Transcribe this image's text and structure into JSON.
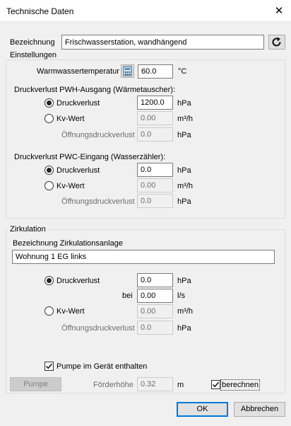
{
  "window": {
    "title": "Technische Daten",
    "close_glyph": "✕"
  },
  "bezeichnung": {
    "label": "Bezeichnung",
    "value": "Frischwasserstation, wandhängend",
    "refresh_icon": "refresh-icon"
  },
  "einstellungen": {
    "group_title": "Einstellungen",
    "warmwasser": {
      "label": "Warmwassertemperatur",
      "value": "60.0",
      "unit": "°C",
      "icon": "calculator-icon"
    },
    "pwh": {
      "title": "Druckverlust PWH-Ausgang (Wärmetauscher):",
      "druckverlust": {
        "label": "Druckverlust",
        "value": "1200.0",
        "unit": "hPa",
        "selected": true
      },
      "kv": {
        "label": "Kv-Wert",
        "value": "0.00",
        "unit": "m³/h",
        "selected": false
      },
      "oeffnung": {
        "label": "Öffnungsdruckverlust",
        "value": "0.0",
        "unit": "hPa"
      }
    },
    "pwc": {
      "title": "Druckverlust PWC-Eingang (Wasserzähler):",
      "druckverlust": {
        "label": "Druckverlust",
        "value": "0.0",
        "unit": "hPa",
        "selected": true
      },
      "kv": {
        "label": "Kv-Wert",
        "value": "0.00",
        "unit": "m³/h",
        "selected": false
      },
      "oeffnung": {
        "label": "Öffnungsdruckverlust",
        "value": "0.0",
        "unit": "hPa"
      }
    }
  },
  "zirkulation": {
    "group_title": "Zirkulation",
    "anlage_label": "Bezeichnung Zirkulationsanlage",
    "anlage_value": "Wohnung 1 EG links",
    "druckverlust": {
      "label": "Druckverlust",
      "value": "0.0",
      "unit": "hPa",
      "selected": true
    },
    "bei": {
      "label": "bei",
      "value": "0.00",
      "unit": "l/s"
    },
    "kv": {
      "label": "Kv-Wert",
      "value": "0.00",
      "unit": "m³/h",
      "selected": false
    },
    "oeffnung": {
      "label": "Öffnungsdruckverlust",
      "value": "0.0",
      "unit": "hPa"
    },
    "pumpe_check": {
      "label": "Pumpe im Gerät enthalten",
      "checked": true
    },
    "pumpe_button": "Pumpe",
    "foerderhoehe": {
      "label": "Förderhöhe",
      "value": "0.32",
      "unit": "m"
    },
    "berechnen": {
      "label": "berechnen",
      "checked": true
    }
  },
  "footer": {
    "ok": "OK",
    "cancel": "Abbrechen"
  }
}
